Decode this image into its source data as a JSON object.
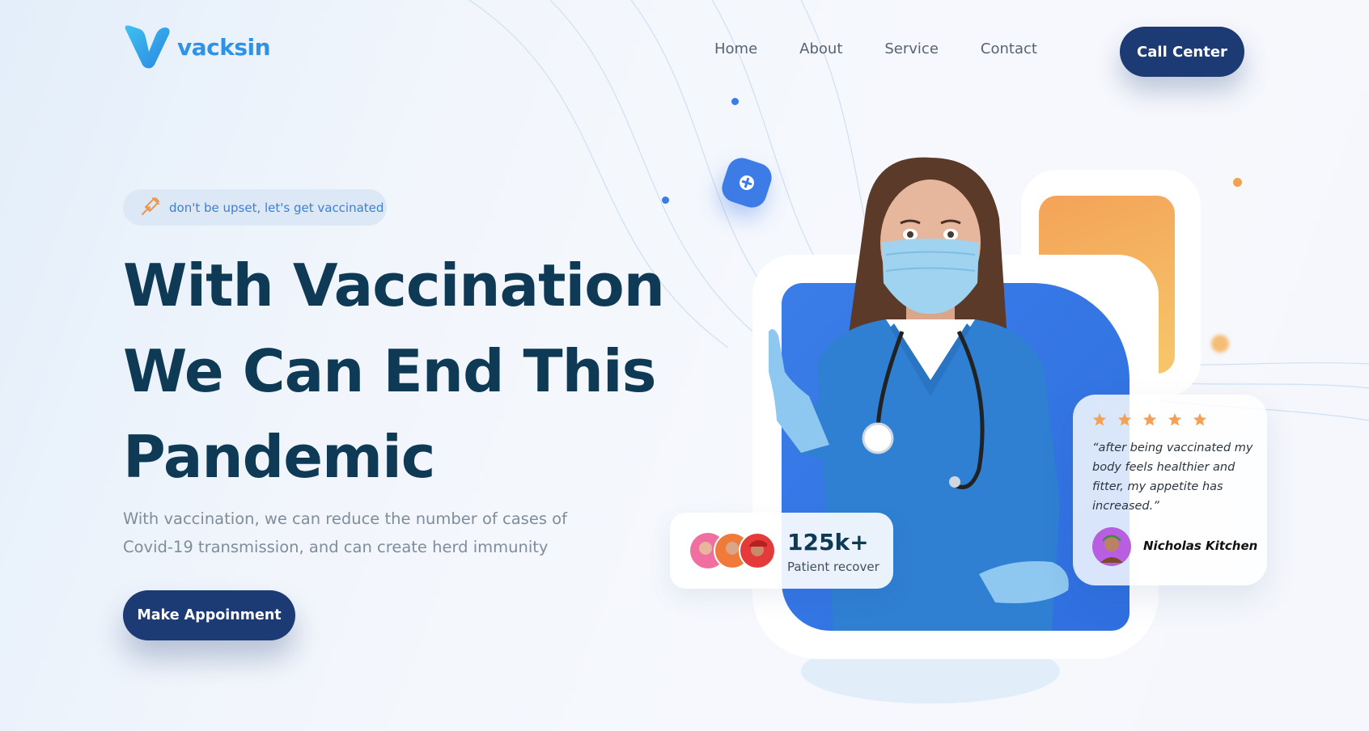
{
  "brand": {
    "name": "vacksin",
    "color": "#2e93e6"
  },
  "nav": {
    "items": [
      {
        "label": "Home"
      },
      {
        "label": "About"
      },
      {
        "label": "Service"
      },
      {
        "label": "Contact"
      }
    ],
    "cta_label": "Call Center"
  },
  "hero": {
    "tag": {
      "icon": "syringe-icon",
      "text": "don't be upset, let's get vaccinated"
    },
    "headline": [
      "With Vaccination",
      "We Can End This",
      "Pandemic"
    ],
    "subtext": "With vaccination, we can reduce the number of cases of Covid-19 transmission, and can create herd immunity",
    "cta_label": "Make Appoinment"
  },
  "stats": {
    "value": "125k+",
    "label": "Patient recover"
  },
  "review": {
    "rating": 5,
    "text": "“after being vaccinated my body feels healthier and fitter, my appetite has increased.”",
    "author": "Nicholas Kitchen"
  },
  "colors": {
    "primary_dark": "#1c3a73",
    "accent_blue": "#3a7de8",
    "accent_orange": "#f3a358",
    "heading": "#0f3a55",
    "star": "#f4a155"
  }
}
